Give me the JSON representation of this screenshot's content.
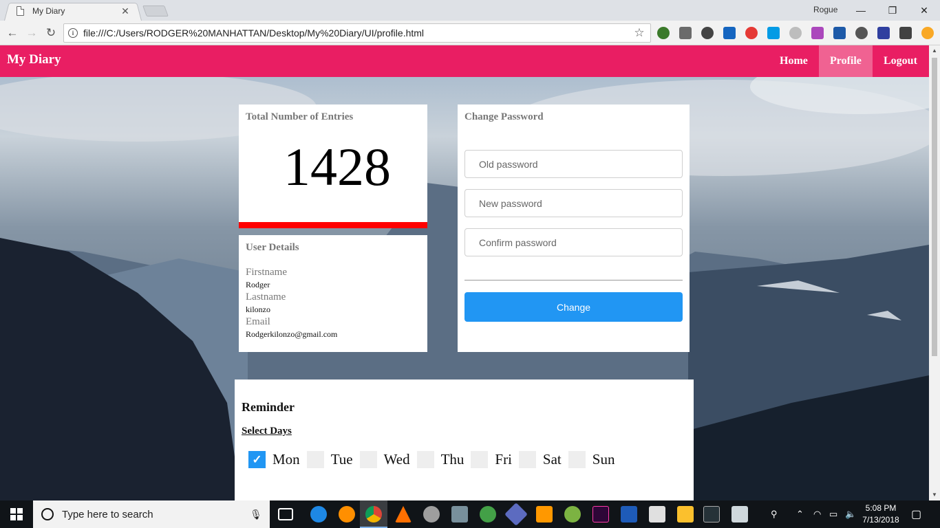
{
  "browser": {
    "tab_title": "My Diary",
    "tab_close": "✕",
    "profile_name": "Rogue",
    "url": "file:///C:/Users/RODGER%20MANHATTAN/Desktop/My%20Diary/UI/profile.html",
    "minimize": "—",
    "restore": "❐",
    "close": "✕",
    "back": "←",
    "forward": "→",
    "reload": "↻",
    "bookmark": "☆"
  },
  "navbar": {
    "brand": "My Diary",
    "links": [
      {
        "label": "Home",
        "active": false
      },
      {
        "label": "Profile",
        "active": true
      },
      {
        "label": "Logout",
        "active": false
      }
    ]
  },
  "entries": {
    "title": "Total Number of Entries",
    "count": "1428"
  },
  "user_details": {
    "title": "User Details",
    "firstname_label": "Firstname",
    "firstname": "Rodger",
    "lastname_label": "Lastname",
    "lastname": "kilonzo",
    "email_label": "Email",
    "email": "Rodgerkilonzo@gmail.com"
  },
  "change_password": {
    "title": "Change Password",
    "old_placeholder": "Old password",
    "new_placeholder": "New password",
    "confirm_placeholder": "Confirm password",
    "button": "Change"
  },
  "reminder": {
    "title": "Reminder",
    "select_days": "Select Days",
    "days": [
      {
        "label": "Mon",
        "checked": true
      },
      {
        "label": "Tue",
        "checked": false
      },
      {
        "label": "Wed",
        "checked": false
      },
      {
        "label": "Thu",
        "checked": false
      },
      {
        "label": "Fri",
        "checked": false
      },
      {
        "label": "Sat",
        "checked": false
      },
      {
        "label": "Sun",
        "checked": false
      }
    ]
  },
  "taskbar": {
    "search_placeholder": "Type here to search",
    "time": "5:08 PM",
    "date": "7/13/2018"
  },
  "colors": {
    "navbar": "#e91e63",
    "nav_active": "#f06292",
    "accent_button": "#2196f3",
    "entries_bar": "#ff0000"
  }
}
